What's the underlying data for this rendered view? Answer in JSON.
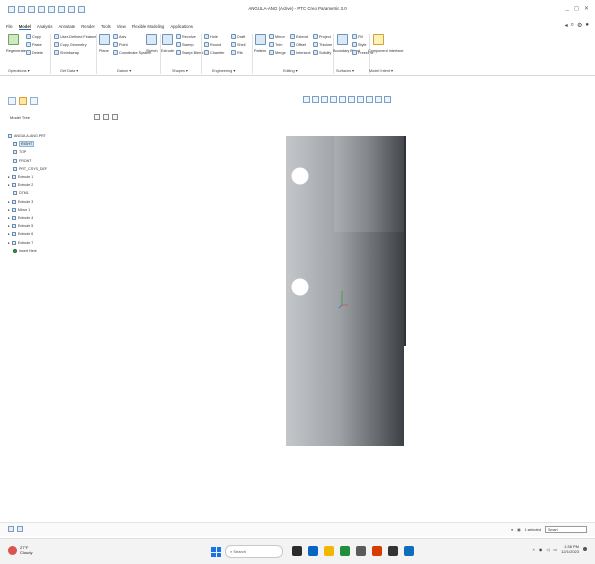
{
  "window": {
    "title": "ANGULA-ANG (Active) - PTC Creo Parametric 3.0",
    "controls": [
      "_",
      "◻",
      "✕"
    ]
  },
  "menu_tabs": [
    "File",
    "Model",
    "Analysis",
    "Annotate",
    "Render",
    "Tools",
    "View",
    "Flexible Modeling",
    "Applications"
  ],
  "active_tab": "Model",
  "ribbon": {
    "items": {
      "regenerate": "Regenerate",
      "copy": "Copy",
      "paste": "Paste",
      "delete": "Delete",
      "user_defined_feature": "User-Defined Feature",
      "copy_geometry": "Copy Geometry",
      "shrinkwrap": "Shrinkwrap",
      "plane": "Plane",
      "axis": "Axis",
      "point": "Point",
      "coordinate_system": "Coordinate System",
      "sketch": "Sketch",
      "extrude": "Extrude",
      "revolve": "Revolve",
      "sweep": "Sweep",
      "swept_blend": "Swept Blend",
      "hole": "Hole",
      "round": "Round",
      "chamfer": "Chamfer",
      "draft": "Draft",
      "shell": "Shell",
      "rib": "Rib",
      "pattern": "Pattern",
      "mirror": "Mirror",
      "extend": "Extend",
      "project": "Project",
      "trim": "Trim",
      "offset": "Offset",
      "thicken": "Thicken",
      "merge": "Merge",
      "intersect": "Intersect",
      "solidify": "Solidify",
      "boundary_blend": "Boundary Blend",
      "freestyle": "Freestyle",
      "fill": "Fill",
      "style": "Style",
      "component_interface": "Component Interface"
    },
    "groups": [
      "Operations ▾",
      "Get Data ▾",
      "Datum ▾",
      "Shapes ▾",
      "Engineering ▾",
      "Editing ▾",
      "Surfaces ▾",
      "Model Intent ▾"
    ]
  },
  "model_tree": {
    "title": "Model Tree",
    "items": [
      {
        "label": "ANGULA-ANG.PRT",
        "icon": "part-icon",
        "indent": 0,
        "selected": false
      },
      {
        "label": "RIGHT",
        "icon": "datum-plane-icon",
        "indent": 1,
        "selected": true
      },
      {
        "label": "TOP",
        "icon": "datum-plane-icon",
        "indent": 1,
        "selected": false
      },
      {
        "label": "FRONT",
        "icon": "datum-plane-icon",
        "indent": 1,
        "selected": false
      },
      {
        "label": "PRT_CSYS_DEF",
        "icon": "csys-icon",
        "indent": 1,
        "selected": false
      },
      {
        "label": "Extrude 1",
        "icon": "extrude-icon",
        "indent": 0,
        "selected": false
      },
      {
        "label": "Extrude 2",
        "icon": "extrude-icon",
        "indent": 0,
        "selected": false
      },
      {
        "label": "DTM1",
        "icon": "datum-plane-icon",
        "indent": 1,
        "selected": false
      },
      {
        "label": "Extrude 3",
        "icon": "extrude-icon",
        "indent": 0,
        "selected": false
      },
      {
        "label": "Mirror 1",
        "icon": "mirror-icon",
        "indent": 0,
        "selected": false
      },
      {
        "label": "Extrude 4",
        "icon": "extrude-icon",
        "indent": 0,
        "selected": false
      },
      {
        "label": "Extrude 5",
        "icon": "extrude-icon",
        "indent": 0,
        "selected": false
      },
      {
        "label": "Extrude 6",
        "icon": "extrude-icon",
        "indent": 0,
        "selected": false
      },
      {
        "label": "Extrude 7",
        "icon": "extrude-icon",
        "indent": 0,
        "selected": false
      },
      {
        "label": "Insert Here",
        "icon": "insert-here-icon",
        "indent": 1,
        "selected": false
      }
    ]
  },
  "status_bar": {
    "selection_count": "1 selected",
    "filter": "Smart"
  },
  "taskbar": {
    "weather_temp": "27°F",
    "weather_desc": "Cloudy",
    "search_placeholder": "Search",
    "time": "1:38 PM",
    "date": "12/1/2023",
    "app_colors": [
      "#2c2c2c",
      "#0a64c2",
      "#f2b705",
      "#1f8f3a",
      "#5a5a5a",
      "#d83b01",
      "#333333",
      "#0f6cbd"
    ]
  },
  "colors": {
    "accent": "#2a6fb0",
    "model_light": "#b9bcc0",
    "model_dark": "#3f4347"
  }
}
